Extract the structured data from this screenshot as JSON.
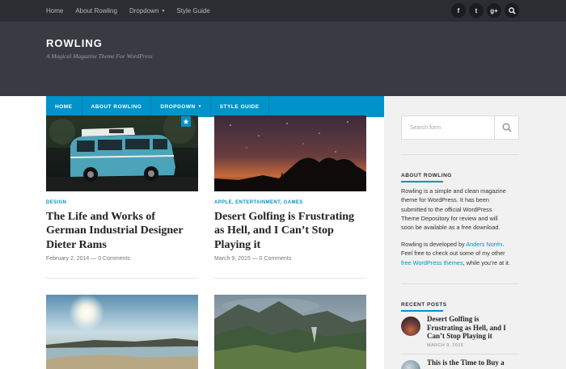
{
  "top_nav": {
    "items": [
      {
        "label": "Home"
      },
      {
        "label": "About Rowling"
      },
      {
        "label": "Dropdown",
        "caret": "▾"
      },
      {
        "label": "Style Guide"
      }
    ],
    "social": [
      {
        "icon": "facebook-icon",
        "glyph": "f"
      },
      {
        "icon": "twitter-icon",
        "glyph": "t"
      },
      {
        "icon": "google-plus-icon",
        "glyph": "g+"
      },
      {
        "icon": "search-icon"
      }
    ]
  },
  "header": {
    "title": "ROWLING",
    "description": "A Magical Magazine Theme For WordPress"
  },
  "primary_nav": {
    "items": [
      {
        "label": "HOME"
      },
      {
        "label": "ABOUT ROWLING"
      },
      {
        "label": "DROPDOWN",
        "caret": "▾"
      },
      {
        "label": "STYLE GUIDE"
      }
    ]
  },
  "posts": [
    {
      "category": "DESIGN",
      "title_lines": [
        "The Life and Works of",
        "German Industrial Designer",
        "Dieter Rams"
      ],
      "date": "February 2, 2014",
      "sep": " — ",
      "comments": "0 Comments"
    },
    {
      "category": "APPLE, ENTERTAINMENT, GAMES",
      "title_lines": [
        "Desert Golfing is Frustrating",
        "as Hell, and I Can’t Stop",
        "Playing it"
      ],
      "date": "March 9, 2015",
      "sep": " — ",
      "comments": "0 Comments"
    }
  ],
  "sidebar": {
    "search_placeholder": "Search form",
    "about": {
      "title": "ABOUT ROWLING",
      "p1_lines": [
        "Rowling is a simple and clean magazine",
        "theme for WordPress. It has been",
        "submitted to the official WordPress",
        "Theme Depository for review and will",
        "soon be available as a free download."
      ],
      "p2_line1_pre": "Rowling is developed by ",
      "p2_line1_link": "Anders Norén",
      "p2_line1_post": ".",
      "p2_line2": "Feel free to check out some of my other",
      "p2_line3_link": "free WordPress themes",
      "p2_line3_post": ", while you’re at it."
    },
    "recent": {
      "title": "RECENT POSTS",
      "items": [
        {
          "title_lines": [
            "Desert Golfing is",
            "Frustrating as Hell, and I",
            "Can’t Stop Playing it"
          ],
          "date": "MARCH 9, 2015"
        },
        {
          "title_lines": [
            "This is the Time to Buy a"
          ],
          "date": ""
        }
      ]
    }
  },
  "colors": {
    "accent": "#0093c9",
    "topbar": "#2a2d32",
    "header": "#383c42",
    "sidebar_bg": "#f1f1f1"
  }
}
